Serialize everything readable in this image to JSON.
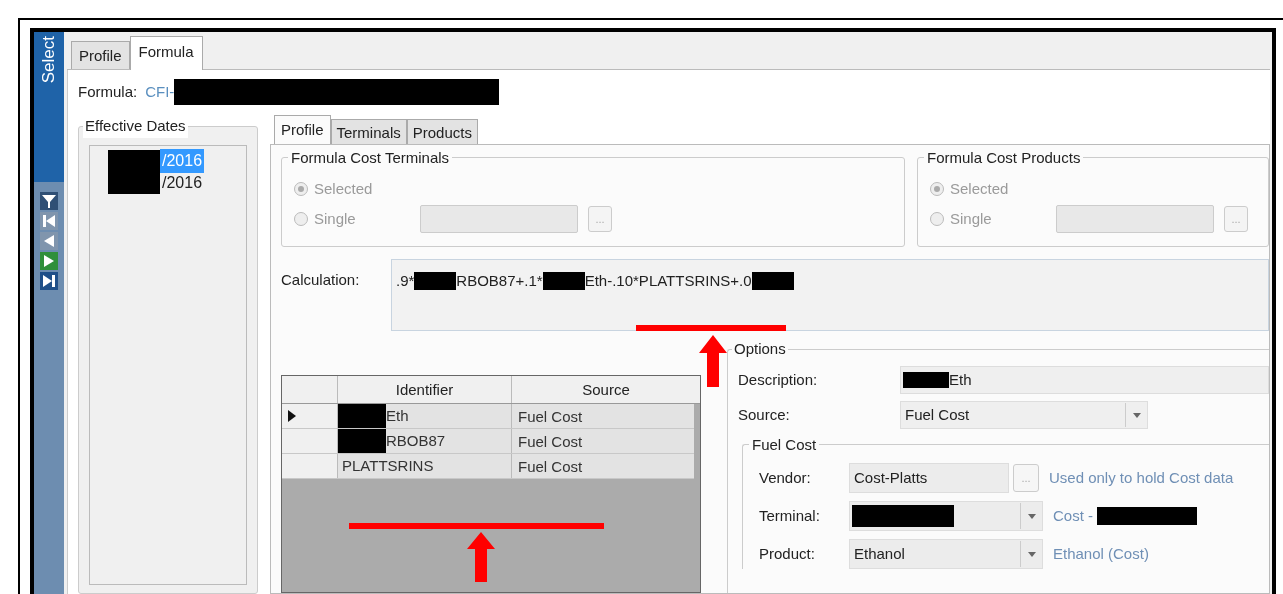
{
  "sidebar": {
    "title": "Select"
  },
  "tabs": [
    {
      "label": "Profile",
      "selected": false
    },
    {
      "label": "Formula",
      "selected": true
    }
  ],
  "formula": {
    "label": "Formula:",
    "value": "CFI-",
    "redacted": true
  },
  "effective_dates": {
    "title": "Effective Dates",
    "items": [
      {
        "text": "/2016",
        "redacted": true,
        "selected": true
      },
      {
        "text": "/2016",
        "redacted": true,
        "selected": false
      }
    ]
  },
  "inner_tabs": [
    {
      "label": "Profile",
      "selected": true
    },
    {
      "label": "Terminals",
      "selected": false
    },
    {
      "label": "Products",
      "selected": false
    }
  ],
  "groups": [
    {
      "title": "Formula Cost Terminals",
      "options": [
        {
          "label": "Selected",
          "checked": true
        },
        {
          "label": "Single",
          "checked": false
        }
      ],
      "button": "..."
    },
    {
      "title": "Formula Cost Products",
      "options": [
        {
          "label": "Selected",
          "checked": true
        },
        {
          "label": "Single",
          "checked": false
        }
      ],
      "button": "..."
    }
  ],
  "calculation": {
    "label": "Calculation:",
    "segments": [
      {
        "kind": "text",
        "text": ".9*"
      },
      {
        "kind": "redaction"
      },
      {
        "kind": "text",
        "text": "RBOB87+.1*"
      },
      {
        "kind": "redaction"
      },
      {
        "kind": "text",
        "text": "Eth-.10*PLATTSRINS+.0"
      },
      {
        "kind": "redaction"
      }
    ]
  },
  "table": {
    "columns": [
      "Identifier",
      "Source"
    ],
    "rows": [
      {
        "current": true,
        "identifier": "Eth",
        "redacted": true,
        "source": "Fuel Cost"
      },
      {
        "current": false,
        "identifier": "RBOB87",
        "redacted": true,
        "source": "Fuel Cost"
      },
      {
        "current": false,
        "identifier": "PLATTSRINS",
        "redacted": false,
        "source": "Fuel Cost"
      }
    ]
  },
  "options": {
    "title": "Options",
    "description": {
      "label": "Description:",
      "value": "Eth",
      "redacted": true
    },
    "source": {
      "label": "Source:",
      "value": "Fuel Cost"
    },
    "fuel_cost": {
      "title": "Fuel Cost",
      "fields": [
        {
          "label": "Vendor:",
          "kind": "lookup",
          "value": "Cost-Platts",
          "redacted": false,
          "button": "...",
          "note": "Used only to hold Cost data",
          "note_redacted": false
        },
        {
          "label": "Terminal:",
          "kind": "combo",
          "redacted": true,
          "note": "Cost - ",
          "note_redacted": true
        },
        {
          "label": "Product:",
          "kind": "combo",
          "value": "Ethanol",
          "redacted": false,
          "note": "Ethanol (Cost)",
          "note_redacted": false
        }
      ]
    }
  }
}
